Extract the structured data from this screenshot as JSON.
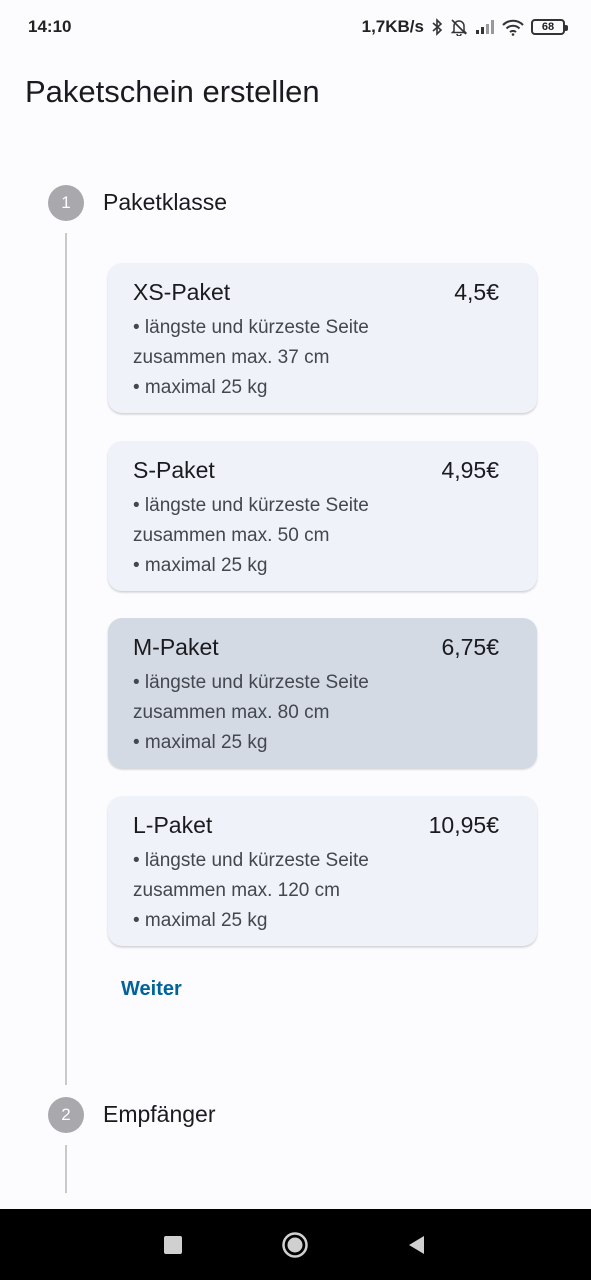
{
  "status_bar": {
    "time": "14:10",
    "net_speed": "1,7KB/s",
    "battery": "68",
    "icons": [
      "bluetooth-icon",
      "bell-off-icon",
      "signal-icon",
      "wifi-icon",
      "battery-icon"
    ]
  },
  "page": {
    "title": "Paketschein erstellen"
  },
  "stepper": {
    "steps": [
      {
        "number": "1",
        "title": "Paketklasse"
      },
      {
        "number": "2",
        "title": "Empfänger"
      }
    ],
    "next_label": "Weiter"
  },
  "packages": [
    {
      "name": "XS-Paket",
      "price": "4,5€",
      "line1": "• längste und kürzeste Seite",
      "line2": "zusammen max. 37 cm",
      "line3": "• maximal 25 kg",
      "selected": false
    },
    {
      "name": "S-Paket",
      "price": "4,95€",
      "line1": "• längste und kürzeste Seite",
      "line2": "zusammen max. 50 cm",
      "line3": "• maximal 25 kg",
      "selected": false
    },
    {
      "name": "M-Paket",
      "price": "6,75€",
      "line1": "• längste und kürzeste Seite",
      "line2": "zusammen max. 80 cm",
      "line3": "• maximal 25 kg",
      "selected": true
    },
    {
      "name": "L-Paket",
      "price": "10,95€",
      "line1": "• längste und kürzeste Seite",
      "line2": "zusammen max. 120 cm",
      "line3": "• maximal 25 kg",
      "selected": false
    }
  ],
  "nav_bar": {
    "icons": [
      "recent-apps-icon",
      "home-icon",
      "back-icon"
    ]
  },
  "colors": {
    "accent": "#00639b",
    "card": "#eff2f8",
    "card_selected": "#d3dae3",
    "step_circle": "#a8a8ad"
  }
}
